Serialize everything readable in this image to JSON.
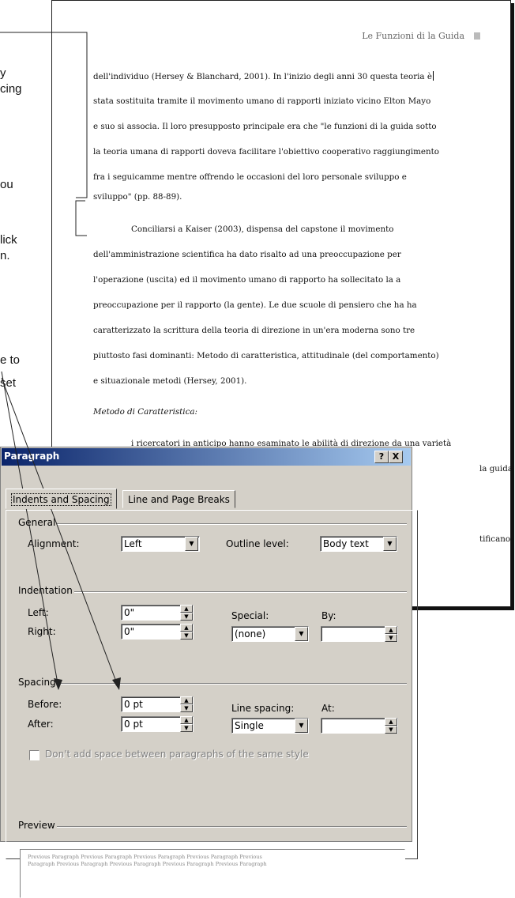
{
  "instructions": [
    "y",
    "cing",
    "ou",
    "lick",
    "n.",
    "e to",
    "set"
  ],
  "document": {
    "header": "Le Funzioni di la Guida",
    "lines": [
      "dell'individuo (Hersey & Blanchard, 2001). In l'inizio degli anni 30 questa teoria è",
      "stata sostituita tramite il movimento umano di rapporti iniziato vicino Elton Mayo",
      "e suo si associa. Il loro presupposto principale era che \"le funzioni di la guida sotto",
      "la teoria umana di rapporti doveva facilitare l'obiettivo cooperativo raggiungimento",
      "fra i seguicamme mentre offrendo le occasioni del loro personale sviluppo e",
      "sviluppo\" (pp. 88-89).",
      "Conciliarsi a Kaiser (2003), dispensa del capstone il movimento",
      "dell'amministrazione scientifica ha dato risalto ad una preoccupazione per",
      "l'operazione (uscita) ed il movimento umano di rapporto ha sollecitato la a",
      "preoccupazione per il rapporto (la gente). Le due scuole di pensiero che ha ha",
      "caratterizzato la scrittura della teoria di direzione in un'era moderna sono tre",
      "piuttosto fasi dominanti: Metodo di caratteristica, attitudinale (del comportamento)",
      "e situazionale metodi (Hersey, 2001).",
      "Metodo di Caratteristica:",
      "i ricercatori in anticipo hanno esaminato le abilità di direzione da una varietà",
      "la guida",
      "tificano"
    ]
  },
  "dialog": {
    "title": "Paragraph",
    "help_label": "?",
    "close_label": "X",
    "tabs": [
      "Indents and Spacing",
      "Line and Page Breaks"
    ],
    "general": {
      "group_label": "General",
      "alignment_label": "Alignment:",
      "alignment_value": "Left",
      "outline_label": "Outline level:",
      "outline_value": "Body text"
    },
    "indentation": {
      "group_label": "Indentation",
      "left_label": "Left:",
      "left_value": "0\"",
      "right_label": "Right:",
      "right_value": "0\"",
      "special_label": "Special:",
      "special_value": "(none)",
      "by_label": "By:",
      "by_value": ""
    },
    "spacing": {
      "group_label": "Spacing",
      "before_label": "Before:",
      "before_value": "0 pt",
      "after_label": "After:",
      "after_value": "0 pt",
      "line_spacing_label": "Line spacing:",
      "line_spacing_value": "Single",
      "at_label": "At:",
      "at_value": "",
      "dont_add_label": "Don't add space between paragraphs of the same style",
      "dont_add_checked": false
    },
    "preview": {
      "group_label": "Preview",
      "lines": [
        "Previous Paragraph Previous Paragraph Previous Paragraph Previous Paragraph Previous",
        "Paragraph Previous Paragraph Previous Paragraph Previous Paragraph Previous Paragraph"
      ]
    }
  }
}
